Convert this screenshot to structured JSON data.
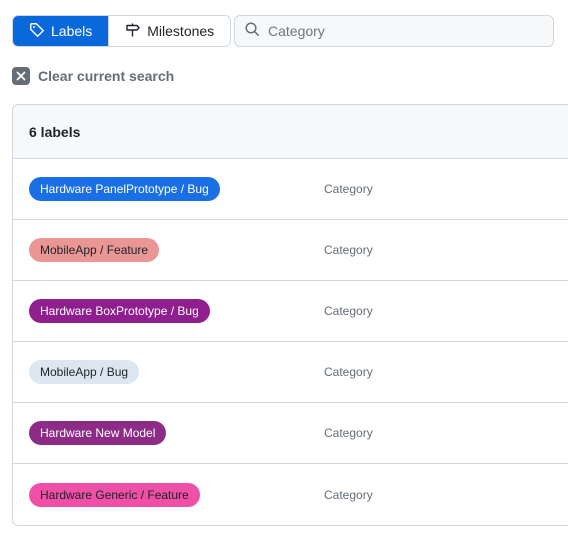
{
  "toolbar": {
    "labels_button": "Labels",
    "milestones_button": "Milestones"
  },
  "search": {
    "placeholder": "Category",
    "value": ""
  },
  "clear": {
    "label": "Clear current search"
  },
  "list": {
    "count_label": "6 labels",
    "items": [
      {
        "name": "Hardware PanelPrototype / Bug",
        "description": "Category",
        "bg": "#1a6fe4",
        "fg": "#ffffff"
      },
      {
        "name": "MobileApp / Feature",
        "description": "Category",
        "bg": "#e99695",
        "fg": "#1f2328"
      },
      {
        "name": "Hardware BoxPrototype / Bug",
        "description": "Category",
        "bg": "#8f1e8f",
        "fg": "#ffffff"
      },
      {
        "name": "MobileApp / Bug",
        "description": "Category",
        "bg": "#dce6f0",
        "fg": "#1f2328"
      },
      {
        "name": "Hardware New Model",
        "description": "Category",
        "bg": "#8d2c87",
        "fg": "#ffffff"
      },
      {
        "name": "Hardware Generic / Feature",
        "description": "Category",
        "bg": "#ef4fa6",
        "fg": "#1f2328"
      }
    ]
  }
}
